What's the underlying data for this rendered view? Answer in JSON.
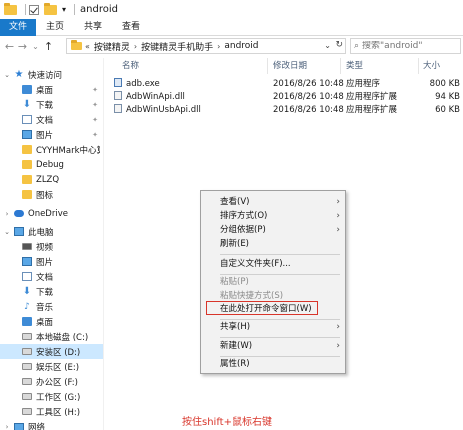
{
  "window": {
    "title": "android"
  },
  "ribbon": {
    "tabs": [
      "文件",
      "主页",
      "共享",
      "查看"
    ]
  },
  "address": {
    "crumbs": [
      "按键精灵",
      "按键精灵手机助手",
      "android"
    ],
    "search_placeholder": "搜索\"android\""
  },
  "sidebar": {
    "items": [
      {
        "label": "快速访问",
        "icon": "star-icon",
        "pinned": false
      },
      {
        "label": "桌面",
        "icon": "desktop-icon",
        "pinned": true
      },
      {
        "label": "下载",
        "icon": "download-icon",
        "pinned": true
      },
      {
        "label": "文档",
        "icon": "document-icon",
        "pinned": true
      },
      {
        "label": "图片",
        "icon": "pictures-icon",
        "pinned": true
      },
      {
        "label": "CYYHMark中心算法",
        "icon": "folder-icon",
        "pinned": false
      },
      {
        "label": "Debug",
        "icon": "folder-icon",
        "pinned": false
      },
      {
        "label": "ZLZQ",
        "icon": "folder-icon",
        "pinned": false
      },
      {
        "label": "图标",
        "icon": "folder-icon",
        "pinned": false
      },
      {
        "label": "OneDrive",
        "icon": "onedrive-icon",
        "pinned": false
      },
      {
        "label": "此电脑",
        "icon": "this-pc-icon",
        "pinned": false
      },
      {
        "label": "视频",
        "icon": "videos-icon",
        "pinned": false
      },
      {
        "label": "图片",
        "icon": "pictures-icon",
        "pinned": false
      },
      {
        "label": "文档",
        "icon": "document-icon",
        "pinned": false
      },
      {
        "label": "下载",
        "icon": "download-icon",
        "pinned": false
      },
      {
        "label": "音乐",
        "icon": "music-icon",
        "pinned": false
      },
      {
        "label": "桌面",
        "icon": "desktop-icon",
        "pinned": false
      },
      {
        "label": "本地磁盘 (C:)",
        "icon": "drive-icon",
        "pinned": false
      },
      {
        "label": "安装区 (D:)",
        "icon": "drive-icon",
        "pinned": false,
        "selected": true
      },
      {
        "label": "娱乐区 (E:)",
        "icon": "drive-icon",
        "pinned": false
      },
      {
        "label": "办公区 (F:)",
        "icon": "drive-icon",
        "pinned": false
      },
      {
        "label": "工作区 (G:)",
        "icon": "drive-icon",
        "pinned": false
      },
      {
        "label": "工具区 (H:)",
        "icon": "drive-icon",
        "pinned": false
      },
      {
        "label": "网络",
        "icon": "network-icon",
        "pinned": false
      }
    ]
  },
  "filelist": {
    "columns": [
      "名称",
      "修改日期",
      "类型",
      "大小"
    ],
    "rows": [
      {
        "name": "adb.exe",
        "date": "2016/8/26 10:48",
        "type": "应用程序",
        "size": "800 KB"
      },
      {
        "name": "AdbWinApi.dll",
        "date": "2016/8/26 10:48",
        "type": "应用程序扩展",
        "size": "94 KB"
      },
      {
        "name": "AdbWinUsbApi.dll",
        "date": "2016/8/26 10:48",
        "type": "应用程序扩展",
        "size": "60 KB"
      }
    ]
  },
  "context_menu": {
    "view": "查看(V)",
    "sort": "排序方式(O)",
    "group": "分组依据(P)",
    "refresh": "刷新(E)",
    "customize": "自定义文件夹(F)...",
    "paste": "粘贴(P)",
    "paste_shortcut": "粘贴快捷方式(S)",
    "open_cmd": "在此处打开命令窗口(W)",
    "share": "共享(H)",
    "new": "新建(W)",
    "properties": "属性(R)"
  },
  "caption": "按住shift+鼠标右键"
}
